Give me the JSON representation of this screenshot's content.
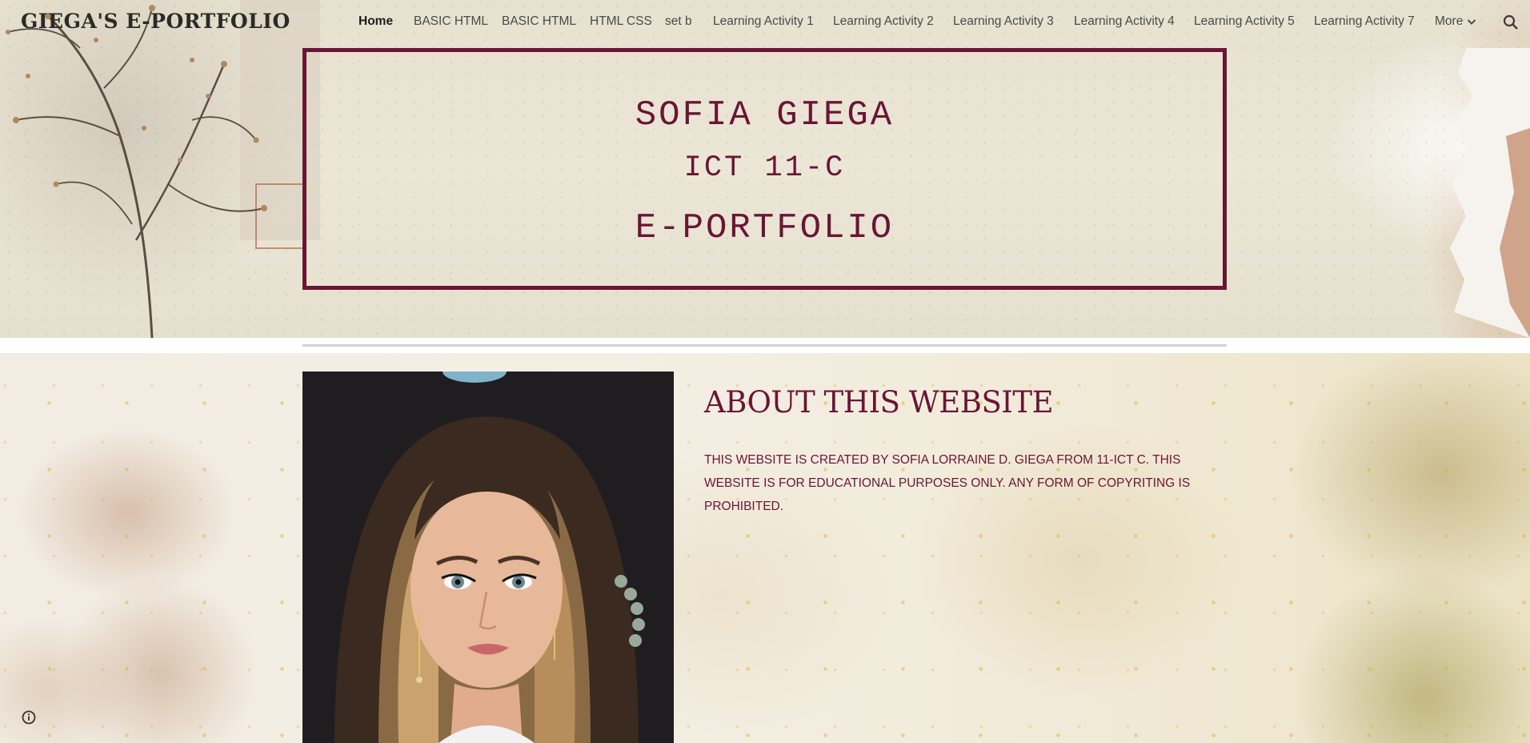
{
  "site": {
    "title": "GIEGA'S E-PORTFOLIO"
  },
  "nav": {
    "items": [
      {
        "label": "Home",
        "active": true
      },
      {
        "label": "BASIC HTML"
      },
      {
        "label": "BASIC HTML"
      },
      {
        "label": "HTML CSS"
      },
      {
        "label": "set b"
      },
      {
        "label": "Learning Activity 1"
      },
      {
        "label": "Learning Activity 2"
      },
      {
        "label": "Learning Activity 3"
      },
      {
        "label": "Learning Activity 4"
      },
      {
        "label": "Learning Activity 5"
      },
      {
        "label": "Learning Activity 7"
      }
    ],
    "more_label": "More",
    "more_icon": "chevron-down-icon",
    "search_icon": "search-icon"
  },
  "hero": {
    "name": "SOFIA GIEGA",
    "section": "ICT 11-C",
    "subtitle": "E-PORTFOLIO"
  },
  "about": {
    "heading": "ABOUT THIS WEBSITE",
    "body": "THIS WEBSITE IS CREATED BY SOFIA LORRAINE D. GIEGA FROM 11-ICT C. THIS WEBSITE IS FOR EDUCATIONAL PURPOSES ONLY. ANY FORM OF COPYRITING IS PROHIBITED."
  },
  "footer": {
    "info_icon": "info-icon"
  },
  "colors": {
    "accent": "#6a1535",
    "nav_text": "#4a4a4a",
    "divider": "#d4d2d0"
  }
}
